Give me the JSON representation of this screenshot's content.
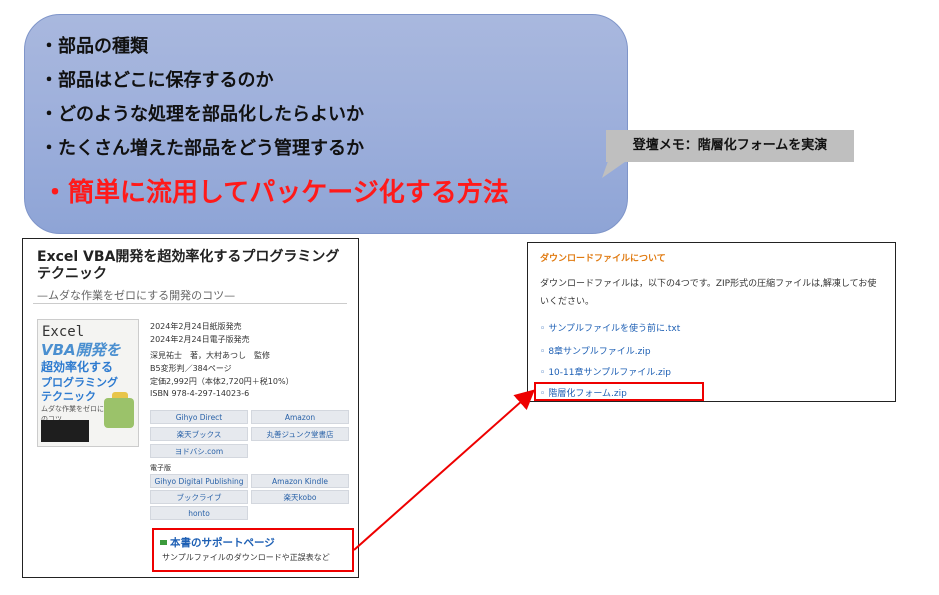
{
  "bubble": {
    "lines": [
      "・部品の種類",
      "・部品はどこに保存するのか",
      "・どのような処理を部品化したらよいか",
      "・たくさん増えた部品をどう管理するか"
    ],
    "highlight": "・簡単に流用してパッケージ化する方法"
  },
  "note": {
    "text": "登壇メモ：階層化フォームを実演"
  },
  "book": {
    "title": "Excel VBA開発を超効率化するプログラミングテクニック",
    "subtitle": "—ムダな作業をゼロにする開発のコツ—",
    "cover": {
      "line1": "Excel",
      "line2": "VBA開発を",
      "line3": "超効率化する",
      "line4": "プログラミング",
      "line5": "テクニック",
      "line6": "ムダな作業をゼロにする開発のコツ"
    },
    "info": [
      "2024年2月24日紙版発売",
      "2024年2月24日電子版発売",
      "深見祐士　著，大村あつし　監修",
      "B5変形判／384ページ",
      "定価2,992円（本体2,720円＋税10%）",
      "ISBN 978-4-297-14023-6"
    ],
    "print_buttons": [
      "Gihyo Direct",
      "Amazon",
      "楽天ブックス",
      "丸善ジュンク堂書店",
      "ヨドバシ.com"
    ],
    "ebook_label": "電子版",
    "ebook_buttons": [
      "Gihyo Digital Publishing",
      "Amazon Kindle",
      "ブックライブ",
      "楽天kobo",
      "honto"
    ],
    "support": {
      "title": "本書のサポートページ",
      "desc": "サンプルファイルのダウンロードや正誤表など"
    }
  },
  "download": {
    "heading": "ダウンロードファイルについて",
    "desc": "ダウンロードファイルは，以下の4つです。ZIP形式の圧縮ファイルは,解凍してお使いください。",
    "files": [
      "サンプルファイルを使う前に.txt",
      "8章サンプルファイル.zip",
      "10-11章サンプルファイル.zip",
      "階層化フォーム.zip"
    ]
  },
  "colors": {
    "accent_red": "#ff1a1a",
    "link_blue": "#1d5fb4",
    "heading_orange": "#e07a10"
  }
}
